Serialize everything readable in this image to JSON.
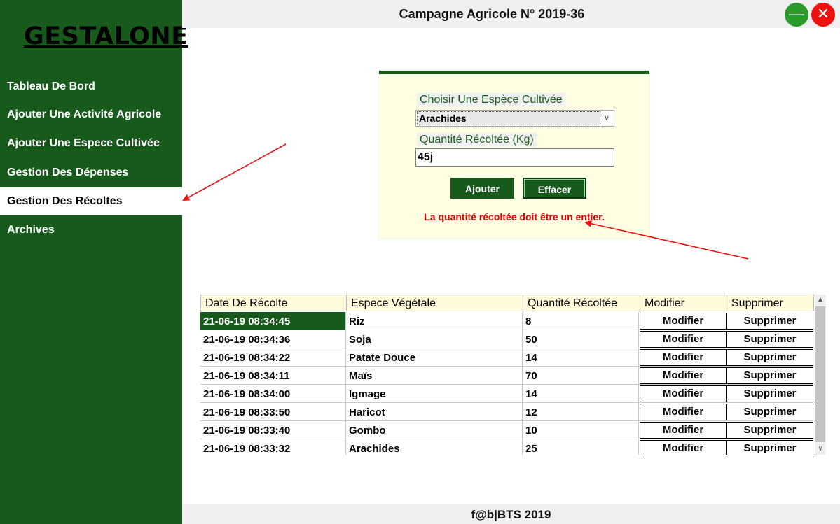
{
  "app": {
    "logo": "GESTALONE",
    "title": "Campagne Agricole N° 2019-36",
    "minimize_icon": "—",
    "close_icon": "✕",
    "footer": "f@b|BTS 2019"
  },
  "sidebar": {
    "items": [
      {
        "label": "Tableau De Bord"
      },
      {
        "label": "Ajouter Une Activité Agricole"
      },
      {
        "label": "Ajouter Une Espece Cultivée"
      },
      {
        "label": "Gestion Des Dépenses"
      },
      {
        "label": "Gestion Des Récoltes",
        "active": true
      },
      {
        "label": "Archives"
      }
    ]
  },
  "form": {
    "species_label": "Choisir Une Espèce Cultivée",
    "species_value": "Arachides",
    "qty_label": "Quantité Récoltée (Kg)",
    "qty_value": "45j",
    "add_label": "Ajouter",
    "clear_label": "Effacer",
    "error": "La quantité récoltée doit être un entier."
  },
  "table": {
    "headers": [
      "Date De Récolte",
      "Espece Végétale",
      "Quantité Récoltée",
      "Modifier",
      "Supprimer"
    ],
    "rows": [
      {
        "date": "21-06-19 08:34:45",
        "espece": "Riz",
        "qty": "8",
        "mod": "Modifier",
        "sup": "Supprimer"
      },
      {
        "date": "21-06-19 08:34:36",
        "espece": "Soja",
        "qty": "50",
        "mod": "Modifier",
        "sup": "Supprimer"
      },
      {
        "date": "21-06-19 08:34:22",
        "espece": "Patate Douce",
        "qty": "14",
        "mod": "Modifier",
        "sup": "Supprimer"
      },
      {
        "date": "21-06-19 08:34:11",
        "espece": "Maïs",
        "qty": "70",
        "mod": "Modifier",
        "sup": "Supprimer"
      },
      {
        "date": "21-06-19 08:34:00",
        "espece": "Igmage",
        "qty": "14",
        "mod": "Modifier",
        "sup": "Supprimer"
      },
      {
        "date": "21-06-19 08:33:50",
        "espece": "Haricot",
        "qty": "12",
        "mod": "Modifier",
        "sup": "Supprimer"
      },
      {
        "date": "21-06-19 08:33:40",
        "espece": "Gombo",
        "qty": "10",
        "mod": "Modifier",
        "sup": "Supprimer"
      },
      {
        "date": "21-06-19 08:33:32",
        "espece": "Arachides",
        "qty": "25",
        "mod": "Modifier",
        "sup": "Supprimer"
      }
    ]
  },
  "colors": {
    "sidebar": "#185a1c",
    "panel": "#fefee2",
    "error": "#e00000",
    "minimize": "#2a9c2a",
    "close": "#ee1111"
  }
}
